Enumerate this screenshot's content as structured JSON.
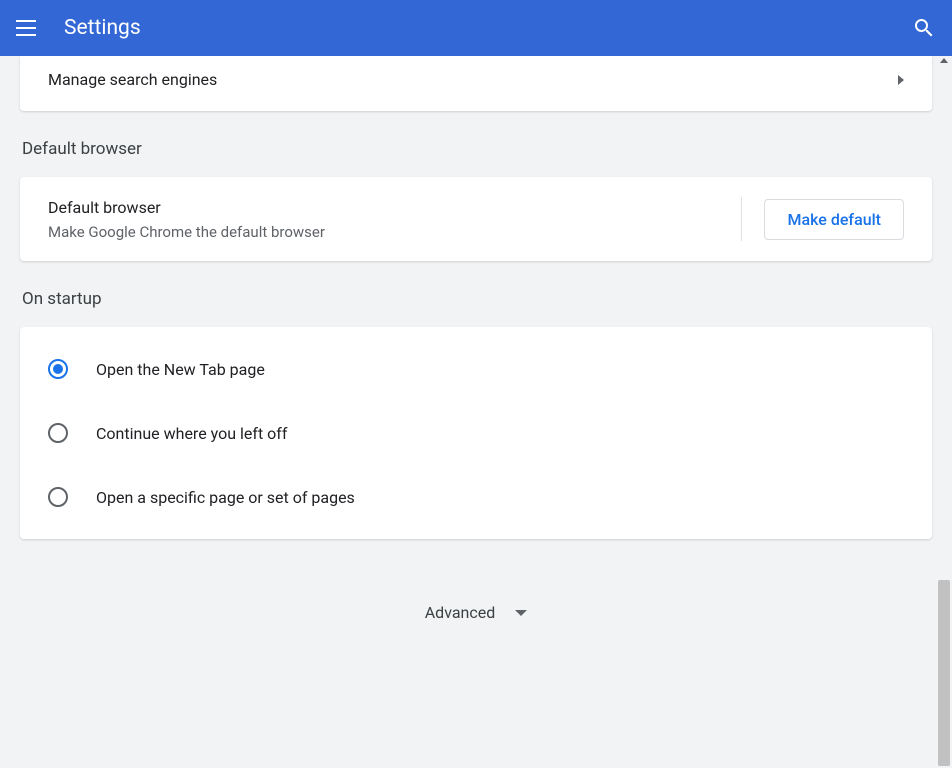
{
  "header": {
    "title": "Settings"
  },
  "searchEngine": {
    "manageLabel": "Manage search engines"
  },
  "defaultBrowser": {
    "sectionTitle": "Default browser",
    "title": "Default browser",
    "subtitle": "Make Google Chrome the default browser",
    "buttonLabel": "Make default"
  },
  "startup": {
    "sectionTitle": "On startup",
    "options": [
      {
        "label": "Open the New Tab page",
        "selected": true
      },
      {
        "label": "Continue where you left off",
        "selected": false
      },
      {
        "label": "Open a specific page or set of pages",
        "selected": false
      }
    ]
  },
  "advanced": {
    "label": "Advanced"
  }
}
